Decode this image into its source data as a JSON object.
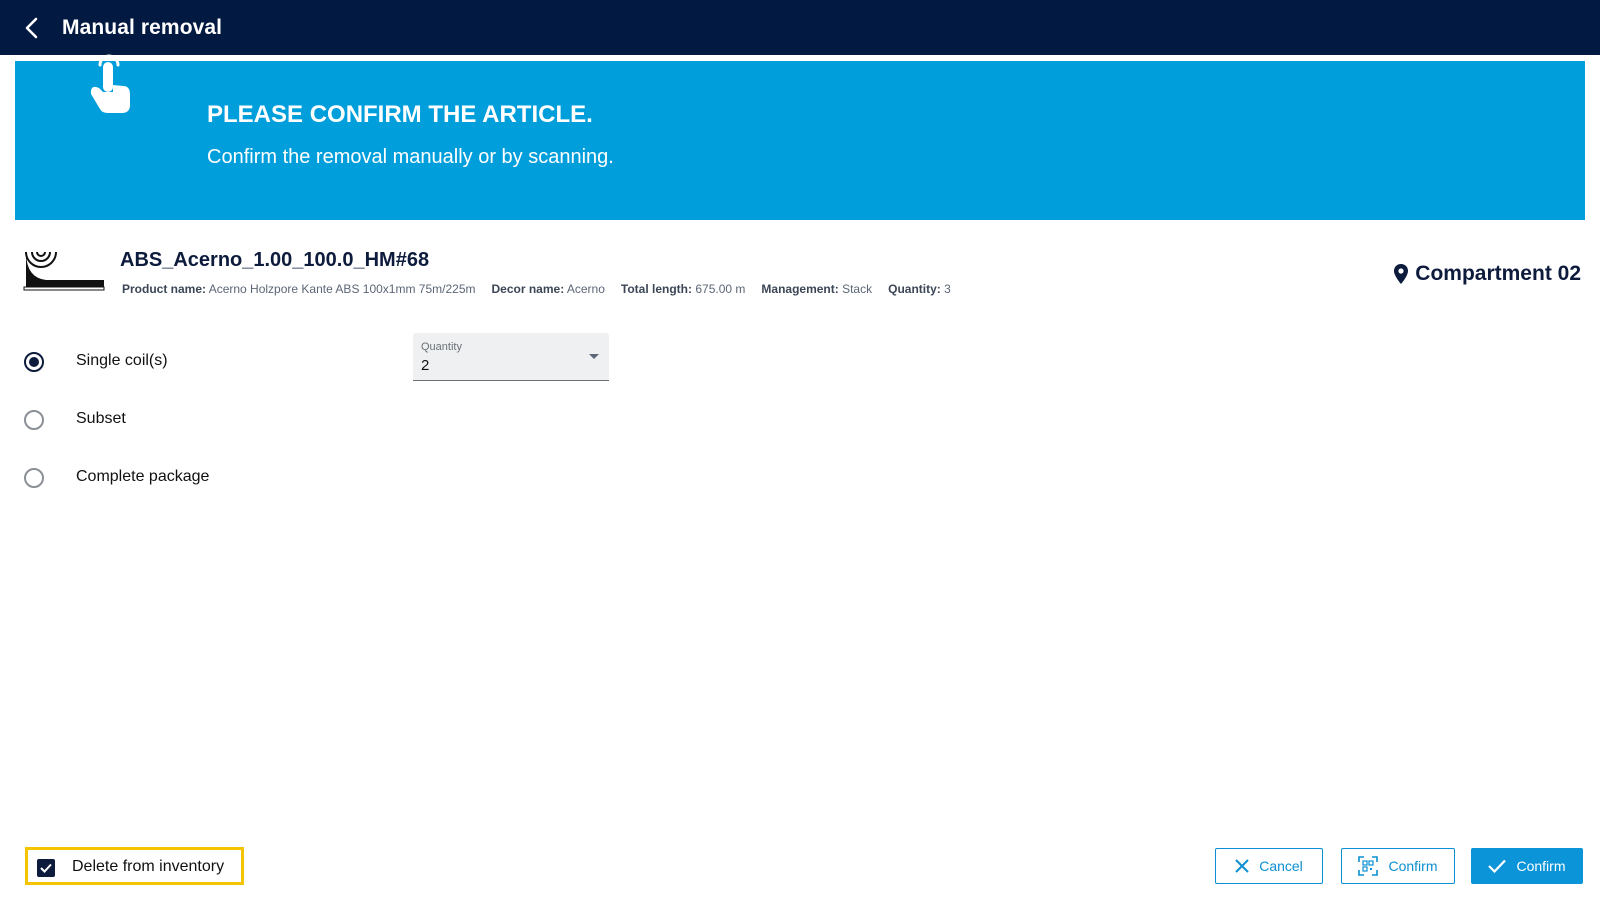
{
  "header": {
    "back_icon": "chevron-left-icon",
    "title": "Manual removal"
  },
  "banner": {
    "icon": "tap-finger-icon",
    "heading": "PLEASE CONFIRM THE ARTICLE.",
    "subtitle": "Confirm the removal manually or by scanning.",
    "background": "#009fdc"
  },
  "article": {
    "icon": "edge-coil-icon",
    "title": "ABS_Acerno_1.00_100.0_HM#68",
    "meta": [
      {
        "label": "Product name:",
        "value": "Acerno Holzpore Kante ABS 100x1mm 75m/225m"
      },
      {
        "label": "Decor name:",
        "value": "Acerno"
      },
      {
        "label": "Total length:",
        "value": "675.00 m"
      },
      {
        "label": "Management:",
        "value": "Stack"
      },
      {
        "label": "Quantity:",
        "value": "3"
      }
    ],
    "compartment_icon": "location-pin-icon",
    "compartment": "Compartment 02"
  },
  "options": [
    {
      "label": "Single coil(s)",
      "selected": true
    },
    {
      "label": "Subset",
      "selected": false
    },
    {
      "label": "Complete package",
      "selected": false
    }
  ],
  "quantity": {
    "label": "Quantity",
    "value": "2"
  },
  "footer": {
    "delete_label": "Delete from inventory",
    "delete_checked": true,
    "cancel_label": "Cancel",
    "scan_confirm_label": "Confirm",
    "confirm_label": "Confirm"
  },
  "colors": {
    "topbar": "#021942",
    "accent": "#0b95d8",
    "highlight": "#f5c400"
  }
}
